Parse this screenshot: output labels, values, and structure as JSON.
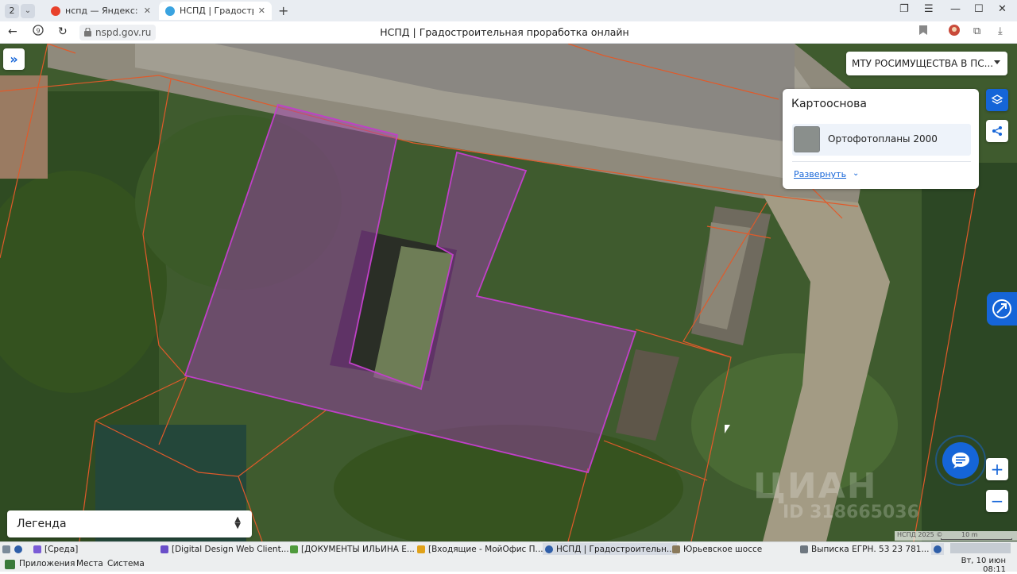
{
  "browser": {
    "tab_counter": "2",
    "tabs": [
      {
        "title": "нспд — Яндекс: нашло",
        "favicon_color": "#e8402a"
      },
      {
        "title": "НСПД | Градостроит",
        "favicon_color": "#3aa3e0"
      }
    ],
    "url": "nspd.gov.ru",
    "page_title": "НСПД | Градостроительная проработка онлайн"
  },
  "map": {
    "org_select": "МТУ РОСИМУЩЕСТВА В ПС...",
    "basemap": {
      "title": "Картооснова",
      "item_label": "Ортофотопланы 2000",
      "expand_link": "Развернуть"
    },
    "legend_label": "Легенда",
    "watermark": "ЦИАН",
    "watermark_id": "ID 318665036",
    "attribution": "НСПД 2025 ©",
    "scale_label": "10 m",
    "zoom_in": "+",
    "zoom_out": "−",
    "accent_color": "#1565d8",
    "parcel_color": "#c040c8"
  },
  "taskbar": {
    "windows": [
      {
        "label": "[Среда]",
        "icon_color": "#7b5cd6"
      },
      {
        "label": "[Digital Design Web Client...",
        "icon_color": "#6a4fc9"
      },
      {
        "label": "[ДОКУМЕНТЫ ИЛЬИНА Е...",
        "icon_color": "#4f9a3c"
      },
      {
        "label": "[Входящие - МойОфис П...",
        "icon_color": "#e0a21a"
      },
      {
        "label": "НСПД | Градостроительн...",
        "icon_color": "#2e5ea8"
      },
      {
        "label": "Юрьевское шоссе",
        "icon_color": "#8a7a5a"
      },
      {
        "label": "Выписка ЕГРН. 53 23 781...",
        "icon_color": "#6e7780"
      }
    ],
    "menu": [
      "Приложения",
      "Места",
      "Система"
    ],
    "clock_day": "Вт, 10 июн",
    "clock_time": "08:11"
  }
}
